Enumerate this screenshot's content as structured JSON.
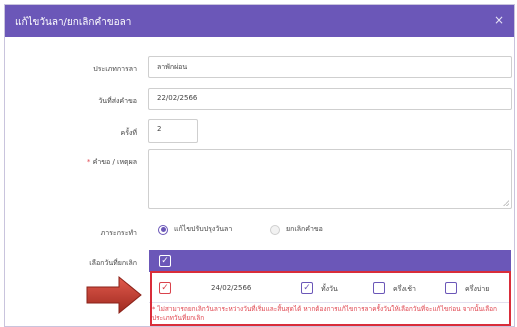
{
  "modal": {
    "title": "แก้ไขวันลา/ยกเลิกคำขอลา",
    "close_glyph": "×"
  },
  "form": {
    "leave_type": {
      "label": "ประเภทการลา",
      "value": "ลาพักผ่อน"
    },
    "submit_date": {
      "label": "วันที่ส่งคำขอ",
      "value": "22/02/2566"
    },
    "times": {
      "label": "ครั้งที่",
      "value": "2"
    },
    "reason": {
      "required_mark": "*",
      "label": "คำขอ / เหตุผล",
      "value": ""
    },
    "action": {
      "label": "ภาระกระทำ",
      "options": [
        {
          "label": "แก้ไขปรับปรุงวันลา",
          "selected": true
        },
        {
          "label": "ยกเลิกคำขอ",
          "selected": false
        }
      ]
    },
    "select_days": {
      "label": "เลือกวันที่ยกเลิก"
    }
  },
  "table": {
    "header_checkbox_checked": true,
    "rows": [
      {
        "checked": true,
        "date": "24/02/2566",
        "full_day": {
          "label": "ทั้งวัน",
          "checked": true
        },
        "morning": {
          "label": "ครึ่งเช้า",
          "checked": false
        },
        "afternoon": {
          "label": "ครึ่งบ่าย",
          "checked": false
        }
      }
    ]
  },
  "warning": "* ไม่สามารถยกเลิกวันลาระหว่างวันที่เริ่มและสิ้นสุดได้ หากต้องการแก้ไขการลาครั้งวันให้เลือกวันที่จะแก้ไขก่อน จากนั้นเลือกประเภทวันที่ยกเลิก",
  "colors": {
    "primary": "#6b57b8",
    "highlight": "#d92d3a",
    "arrow": "#c0392b"
  },
  "icons": {
    "check": "✓"
  }
}
